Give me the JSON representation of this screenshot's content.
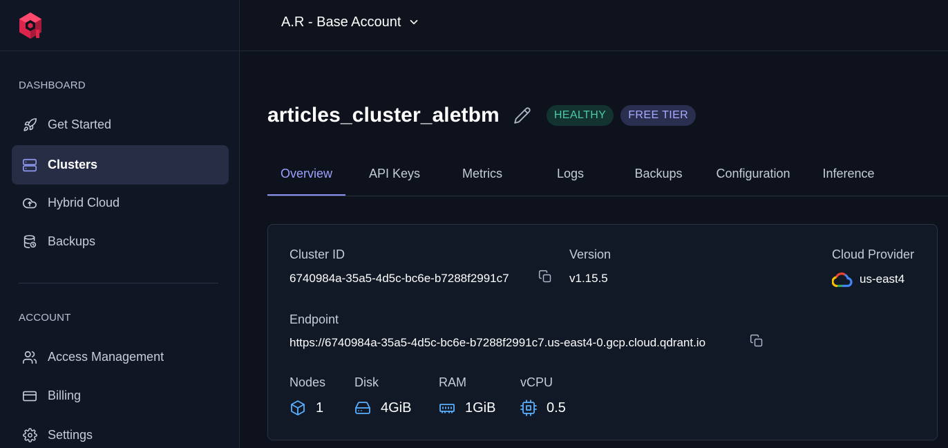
{
  "sidebar": {
    "logo_icon": "qdrant-logo",
    "sections": {
      "dashboard_label": "DASHBOARD",
      "account_label": "ACCOUNT"
    },
    "items": [
      {
        "label": "Get Started",
        "icon": "rocket-icon"
      },
      {
        "label": "Clusters",
        "icon": "server-icon",
        "active": true
      },
      {
        "label": "Hybrid Cloud",
        "icon": "cloud-sync-icon"
      },
      {
        "label": "Backups",
        "icon": "database-backup-icon"
      },
      {
        "label": "Access Management",
        "icon": "users-icon"
      },
      {
        "label": "Billing",
        "icon": "credit-card-icon"
      },
      {
        "label": "Settings",
        "icon": "gear-icon"
      }
    ]
  },
  "header": {
    "account_name": "A.R - Base Account"
  },
  "cluster": {
    "name": "articles_cluster_aletbm",
    "status_badge": "HEALTHY",
    "tier_badge": "FREE TIER"
  },
  "tabs": [
    {
      "label": "Overview",
      "active": true
    },
    {
      "label": "API Keys"
    },
    {
      "label": "Metrics"
    },
    {
      "label": "Logs"
    },
    {
      "label": "Backups"
    },
    {
      "label": "Configuration"
    },
    {
      "label": "Inference"
    }
  ],
  "details": {
    "cluster_id_label": "Cluster ID",
    "cluster_id": "6740984a-35a5-4d5c-bc6e-b7288f2991c7",
    "version_label": "Version",
    "version": "v1.15.5",
    "cloud_provider_label": "Cloud Provider",
    "region": "us-east4",
    "endpoint_label": "Endpoint",
    "endpoint": "https://6740984a-35a5-4d5c-bc6e-b7288f2991c7.us-east4-0.gcp.cloud.qdrant.io",
    "resources": {
      "nodes_label": "Nodes",
      "nodes": "1",
      "disk_label": "Disk",
      "disk": "4GiB",
      "ram_label": "RAM",
      "ram": "1GiB",
      "vcpu_label": "vCPU",
      "vcpu": "0.5"
    }
  },
  "colors": {
    "accent": "#8a92f2",
    "healthy": "#4ccaa5",
    "brand": "#dc244c",
    "resource_icon": "#5ab0ff"
  }
}
